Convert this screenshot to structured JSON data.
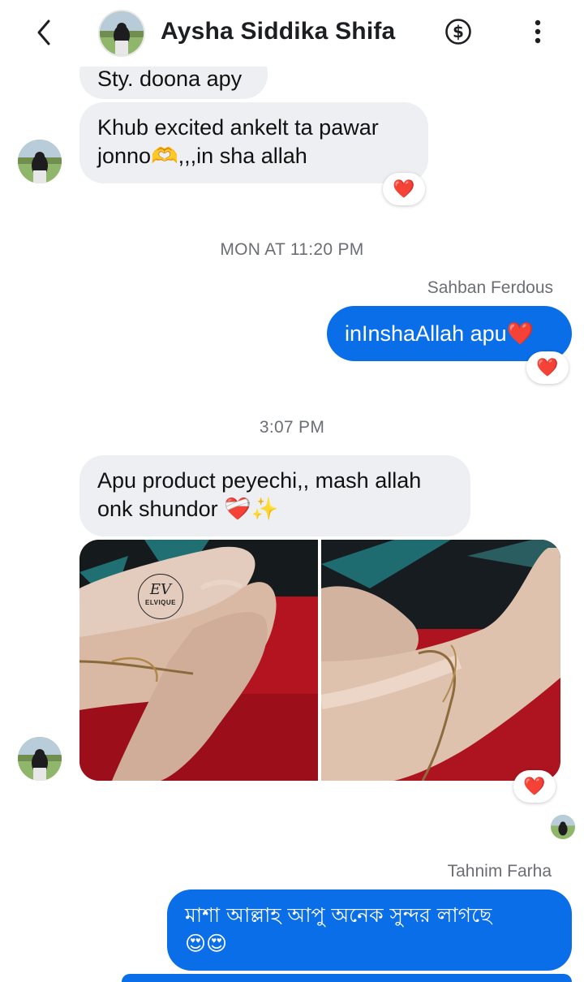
{
  "header": {
    "contact_name": "Aysha Siddika Shifa",
    "back_icon": "chevron-left-icon",
    "payment_icon": "dollar-circle-icon",
    "menu_icon": "more-vertical-icon"
  },
  "messages": {
    "partial_incoming": "Sty. doona apy",
    "msg1": {
      "line1": "Khub excited ankelt ta pawar",
      "line2": "jonno🫶,,,in sha allah",
      "reaction": "❤️"
    },
    "timestamp1": "MON AT 11:20 PM",
    "sender1": "Sahban Ferdous",
    "msg2": {
      "text": "inInshaAllah apu❤️",
      "reaction": "❤️"
    },
    "timestamp2": "3:07 PM",
    "msg3": {
      "line1": "Apu product peyechi,, mash allah",
      "line2": "onk shundor ❤️‍🩹✨"
    },
    "photo_watermark_monogram": "EV",
    "photo_watermark_text": "ELVIQUE",
    "photo_reaction": "❤️",
    "sender2": "Tahnim Farha",
    "msg4": {
      "line1": "মাশা আল্লাহ আপু অনেক সুন্দর লাগছে",
      "line2": "😍😍"
    }
  },
  "colors": {
    "outgoing_bubble": "#0a6ee8",
    "incoming_bubble": "#eeeff3",
    "meta_text": "#6b6e73"
  }
}
